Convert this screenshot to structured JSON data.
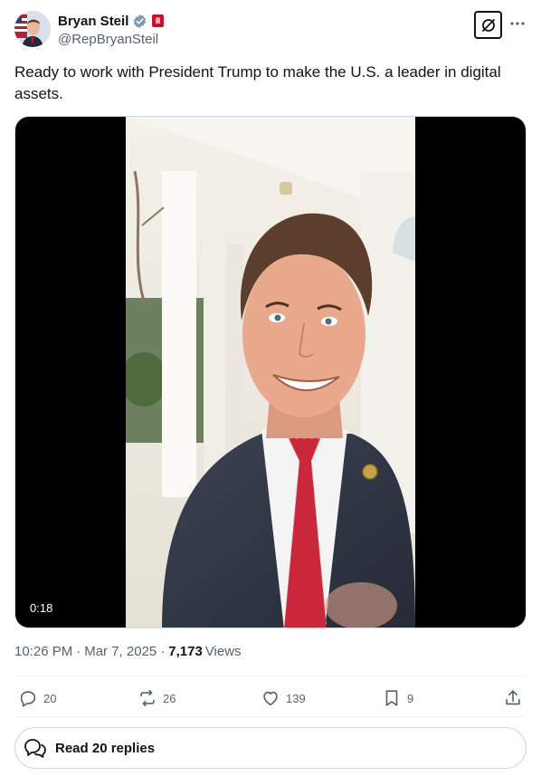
{
  "author": {
    "display_name": "Bryan Steil",
    "handle": "@RepBryanSteil",
    "verified": true,
    "affiliation_badge": "government-badge"
  },
  "tweet": {
    "text": "Ready to work with President Trump to make the U.S. a leader in digital assets."
  },
  "media": {
    "type": "video",
    "duration": "0:18"
  },
  "meta": {
    "time": "10:26 PM",
    "date": "Mar 7, 2025",
    "views_count": "7,173",
    "views_label": "Views"
  },
  "actions": {
    "replies": "20",
    "reposts": "26",
    "likes": "139",
    "bookmarks": "9"
  },
  "read_replies_label": "Read 20 replies",
  "colors": {
    "verified_blue": "#829aab",
    "text_primary": "#0f1419",
    "text_secondary": "#536471",
    "border": "#cfd9de",
    "affiliation_red": "#c8102e"
  }
}
